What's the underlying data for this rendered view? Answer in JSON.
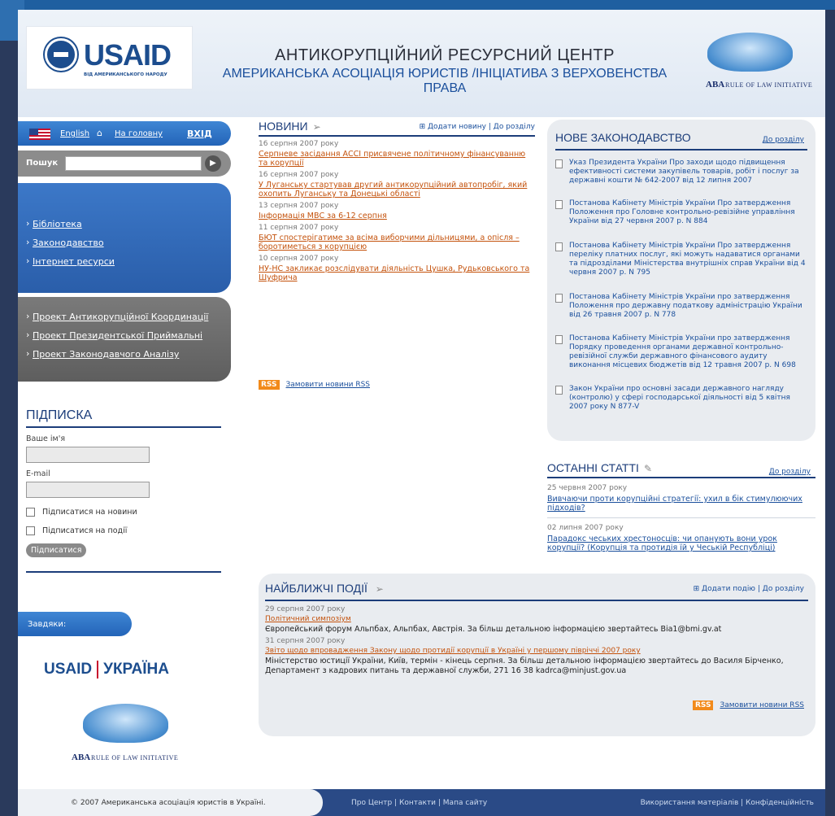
{
  "header": {
    "usaid_word": "USAID",
    "usaid_sub": "ВІД АМЕРИКАНСЬКОГО НАРОДУ",
    "title_line1": "АНТИКОРУПЦІЙНИЙ РЕСУРСНИЙ ЦЕНТР",
    "title_line2": "АМЕРИКАНСЬКА АСОЦІАЦІЯ ЮРИСТІВ /ІНІЦІАТИВА З ВЕРХОВЕНСТВА ПРАВА",
    "aba_mark": "ABA",
    "aba_text": "RULE OF LAW INITIATIVE"
  },
  "sidebar": {
    "lang": "English",
    "home": "На головну",
    "login": "ВХІД",
    "search_label": "Пошук",
    "nav_primary": [
      "Бібліотека",
      "Законодавство",
      "Інтернет ресурси"
    ],
    "nav_projects": [
      "Проект Антикорупційної Координації",
      "Проект Президентської Приймальні",
      "Проект Законодавчого Аналізу"
    ]
  },
  "subscribe": {
    "title": "ПІДПИСКА",
    "name_label": "Ваше ім'я",
    "email_label": "E-mail",
    "check_news": "Підписатися на новини",
    "check_events": "Підписатися на події",
    "button": "Підписатися"
  },
  "thanks": {
    "label": "Завдяки:",
    "usaid": "USAID",
    "ukraine": "УКРАЇНА"
  },
  "news": {
    "title": "НОВИНИ",
    "add": "⊞ Додати новину",
    "sep": "|",
    "section": "До розділу",
    "items": [
      {
        "date": "16 серпня 2007 року",
        "text": "Серпневе засідання АССІ присвячене політичному фінансуванню та корупції"
      },
      {
        "date": "16 серпня 2007 року",
        "text": "У Луганську стартував другий антикорупційний автопробіг, який охопить Луганську та Донецькі області"
      },
      {
        "date": "13 серпня 2007 року",
        "text": "Інформація МВС за 6-12 серпня"
      },
      {
        "date": "11 серпня 2007 року",
        "text": "БЮТ спостерігатиме за всіма виборчими дільницями, а опісля – боротиметься з корупцією"
      },
      {
        "date": "10 серпня 2007 року",
        "text": "НУ-НС закликає розслідувати діяльність Цушка, Рудьковського та Шуфрича"
      }
    ],
    "rss": "RSS",
    "rss_link": "Замовити новини RSS"
  },
  "laws": {
    "title": "НОВЕ ЗАКОНОДАВСТВО",
    "more": "До розділу",
    "items": [
      {
        "link": "Указ Президента України Про заходи щодо підвищення ефективності системи закупівель товарів, робіт і послуг за державні кошти № 642-2007 від 12 липня 2007"
      },
      {
        "link": "Постанова Кабінету Міністрів України Про затвердження Положення про Головне контрольно-ревізійне управління України від 27 червня 2007 р. N 884"
      },
      {
        "link": "Постанова Кабінету Міністрів України Про затвердження переліку платних послуг, які можуть надаватися органами та підрозділами Міністерства внутрішніх справ України від 4 червня 2007 р. N 795"
      },
      {
        "link": "Постанова Кабінету Міністрів України про затвердження Положення про державну податкову адміністрацію України від 26 травня 2007 р. N 778"
      },
      {
        "link": "Постанова Кабінету Міністрів України про затвердження Порядку проведення органами державної контрольно-ревізійної служби державного фінансового аудиту виконання місцевих бюджетів від 12 травня 2007 р. N 698"
      },
      {
        "link": "Закон України про основні засади державного нагляду (контролю) у сфері господарської діяльності від 5 квітня 2007 року N 877-V"
      }
    ]
  },
  "articles": {
    "title": "ОСТАННІ СТАТТІ",
    "more": "До розділу",
    "items": [
      {
        "date": "25 червня 2007 року",
        "text": "Вивчаючи проти корупційні стратегії: ухил в бік стимулюючих підходів?"
      },
      {
        "date": "02 липня 2007 року",
        "text": "Парадокс чеських хрестоносців: чи опанують вони урок корупції? (Корупція та протидія їй у Чеській Республіці)"
      }
    ]
  },
  "events": {
    "title": "НАЙБЛИЖЧІ ПОДІЇ",
    "add": "⊞ Додати подію",
    "sep": "|",
    "section": "До розділу",
    "items": [
      {
        "date": "29 серпня 2007 року",
        "link": "Політичний симпозіум",
        "desc": "Європейський форум Альпбах, Альпбах, Австрія. За більш детальною інформацією звертайтесь Bia1@bmi.gv.at"
      },
      {
        "date": "31 серпня 2007 року",
        "link": "Звіто щодо впровадження Закону щодо протидії корупції в Україні у першому півріччі 2007 року",
        "desc": "Міністерство юстиції України, Київ, термін - кінець серпня. За більш детальною інформацією звертайтесь до Василя Бірченко, Департамент з кадрових питань та державної служби, 271 16 38 kadrca@minjust.gov.ua"
      }
    ],
    "rss": "RSS",
    "rss_link": "Замовити новини RSS"
  },
  "footer": {
    "copy": "© 2007 Американська асоціація юристів в Україні.",
    "mid": "Про Центр  |  Контакти  |  Мапа сайту",
    "right": "Використання матеріалів  |  Конфіденційність"
  }
}
